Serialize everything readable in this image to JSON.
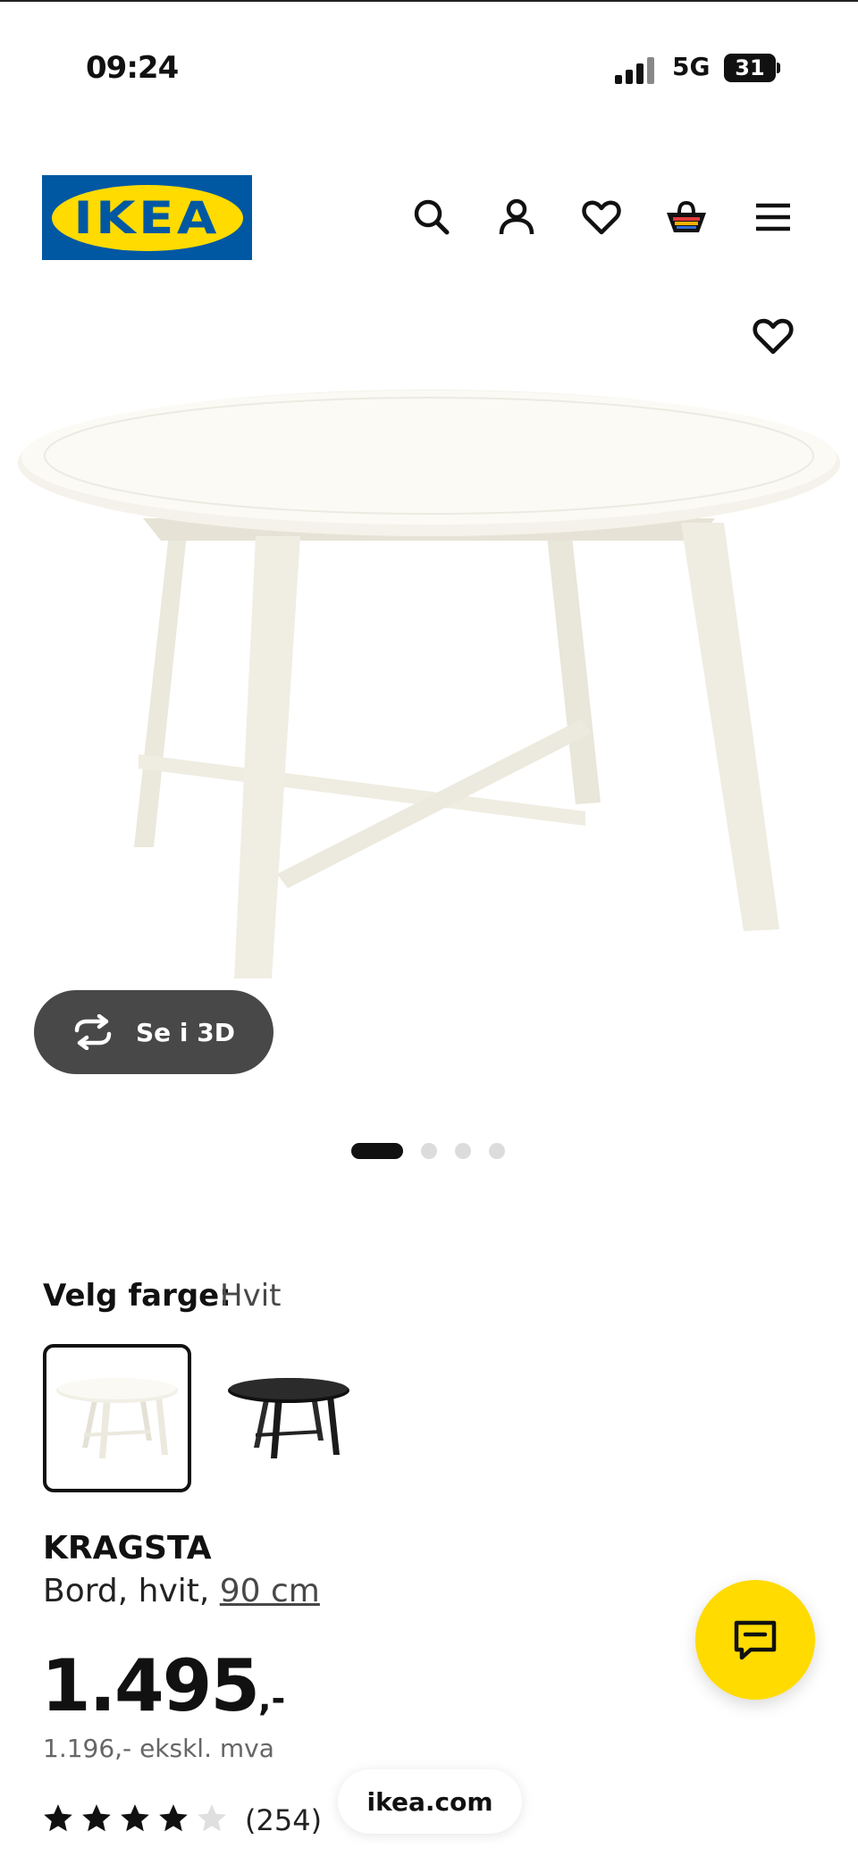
{
  "status_bar": {
    "time": "09:24",
    "network": "5G",
    "battery": "31"
  },
  "header": {
    "logo_text": "IKEA",
    "icons": [
      "search-icon",
      "account-icon",
      "heart-icon",
      "basket-icon",
      "menu-icon"
    ]
  },
  "gallery": {
    "view_3d_label": "Se i 3D",
    "slide_count": 4,
    "active_slide": 1
  },
  "color_picker": {
    "label": "Velg farge:",
    "selected_value": "Hvit",
    "options": [
      "white",
      "black"
    ]
  },
  "product": {
    "name": "KRAGSTA",
    "description_prefix": "Bord, hvit, ",
    "size": "90 cm",
    "price_main": "1.495",
    "price_suffix": ",-",
    "price_ex_vat": "1.196,- ekskl. mva",
    "rating": 4,
    "rating_max": 5,
    "review_count": "(254)"
  },
  "browser": {
    "url": "ikea.com"
  },
  "colors": {
    "ikea_blue": "#0058a3",
    "ikea_yellow": "#ffdb00",
    "button_dark": "#484848"
  }
}
